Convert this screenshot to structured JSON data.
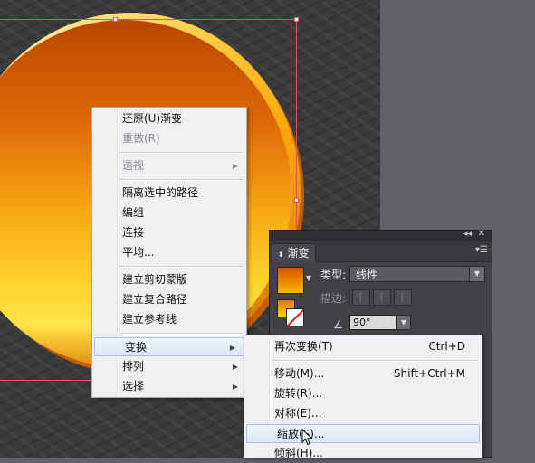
{
  "context_menu": {
    "items": [
      {
        "label": "还原(U)渐变",
        "disabled": false
      },
      {
        "label": "重做(R)",
        "disabled": true
      },
      {
        "label": "透视",
        "disabled": true,
        "submenu": true
      },
      {
        "label": "隔离选中的路径",
        "disabled": false
      },
      {
        "label": "编组",
        "disabled": false
      },
      {
        "label": "连接",
        "disabled": false
      },
      {
        "label": "平均...",
        "disabled": false
      },
      {
        "label": "建立剪切蒙版",
        "disabled": false
      },
      {
        "label": "建立复合路径",
        "disabled": false
      },
      {
        "label": "建立参考线",
        "disabled": false
      },
      {
        "label": "变换",
        "disabled": false,
        "submenu": true,
        "highlighted": true
      },
      {
        "label": "排列",
        "disabled": false,
        "submenu": true
      },
      {
        "label": "选择",
        "disabled": false,
        "submenu": true
      }
    ]
  },
  "transform_submenu": {
    "items": [
      {
        "label": "再次变换(T)",
        "shortcut": "Ctrl+D"
      },
      {
        "label": "移动(M)...",
        "shortcut": "Shift+Ctrl+M"
      },
      {
        "label": "旋转(R)...",
        "shortcut": ""
      },
      {
        "label": "对称(E)...",
        "shortcut": ""
      },
      {
        "label": "缩放(S)...",
        "shortcut": "",
        "highlighted": true
      },
      {
        "label": "倾斜(H)...",
        "shortcut": ""
      }
    ]
  },
  "gradient_panel": {
    "tab_title": "渐变",
    "type_label": "类型:",
    "type_value": "线性",
    "stroke_label": "描边:",
    "angle_value": "90°",
    "collapse_icon": "double-chevron-icon",
    "close_icon": "close-icon"
  },
  "colors": {
    "selection": "#e8505d",
    "menu_bg": "#f0eff2",
    "panel_bg": "#434146",
    "gradient_start": "#b94600",
    "gradient_end": "#ffe44a"
  }
}
